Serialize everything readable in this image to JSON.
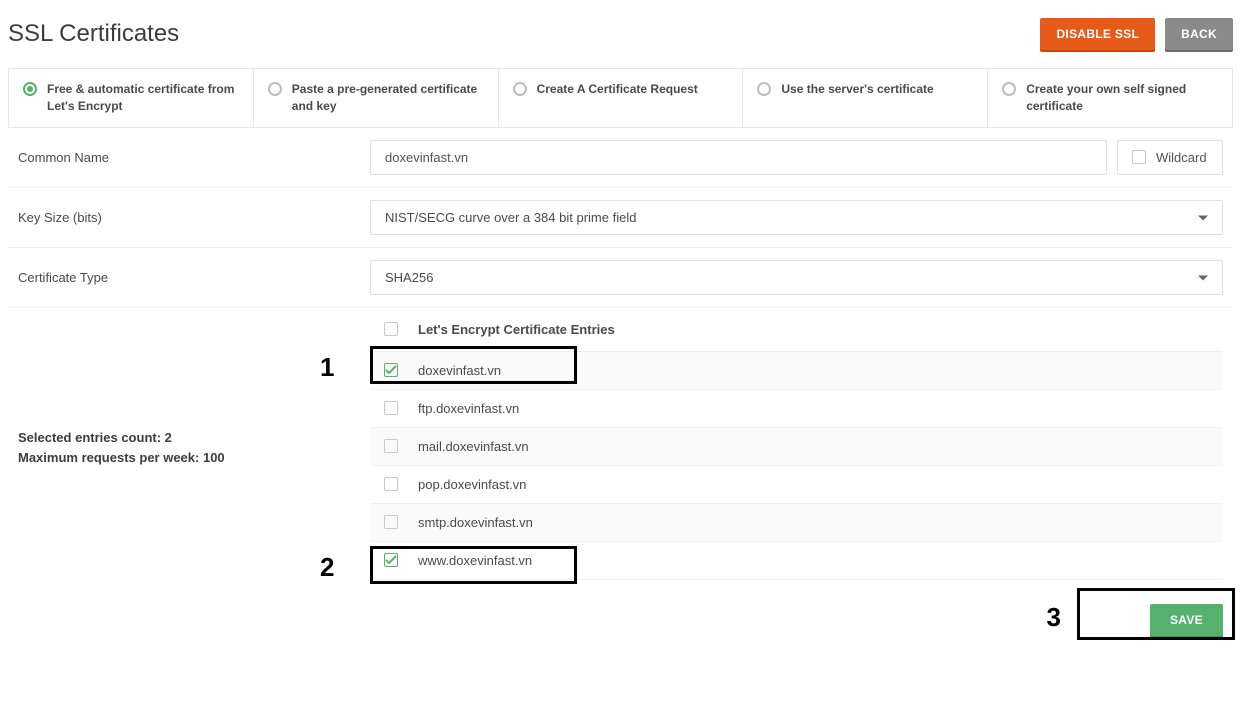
{
  "header": {
    "title": "SSL Certificates",
    "disable_btn": "DISABLE SSL",
    "back_btn": "BACK"
  },
  "tabs": [
    {
      "label": "Free & automatic certificate from Let's Encrypt",
      "active": true
    },
    {
      "label": "Paste a pre-generated certificate and key",
      "active": false
    },
    {
      "label": "Create A Certificate Request",
      "active": false
    },
    {
      "label": "Use the server's certificate",
      "active": false
    },
    {
      "label": "Create your own self signed certificate",
      "active": false
    }
  ],
  "form": {
    "common_name_label": "Common Name",
    "common_name_value": "doxevinfast.vn",
    "wildcard_label": "Wildcard",
    "keysize_label": "Key Size (bits)",
    "keysize_value": "NIST/SECG curve over a 384 bit prime field",
    "certtype_label": "Certificate Type",
    "certtype_value": "SHA256"
  },
  "entries": {
    "header_label": "Let's Encrypt Certificate Entries",
    "selected_count_label": "Selected entries count: 2",
    "max_requests_label": "Maximum requests per week: 100",
    "items": [
      {
        "label": "doxevinfast.vn",
        "checked": true
      },
      {
        "label": "ftp.doxevinfast.vn",
        "checked": false
      },
      {
        "label": "mail.doxevinfast.vn",
        "checked": false
      },
      {
        "label": "pop.doxevinfast.vn",
        "checked": false
      },
      {
        "label": "smtp.doxevinfast.vn",
        "checked": false
      },
      {
        "label": "www.doxevinfast.vn",
        "checked": true
      }
    ]
  },
  "footer": {
    "save_btn": "SAVE"
  },
  "annotations": {
    "a1": "1",
    "a2": "2",
    "a3": "3"
  }
}
